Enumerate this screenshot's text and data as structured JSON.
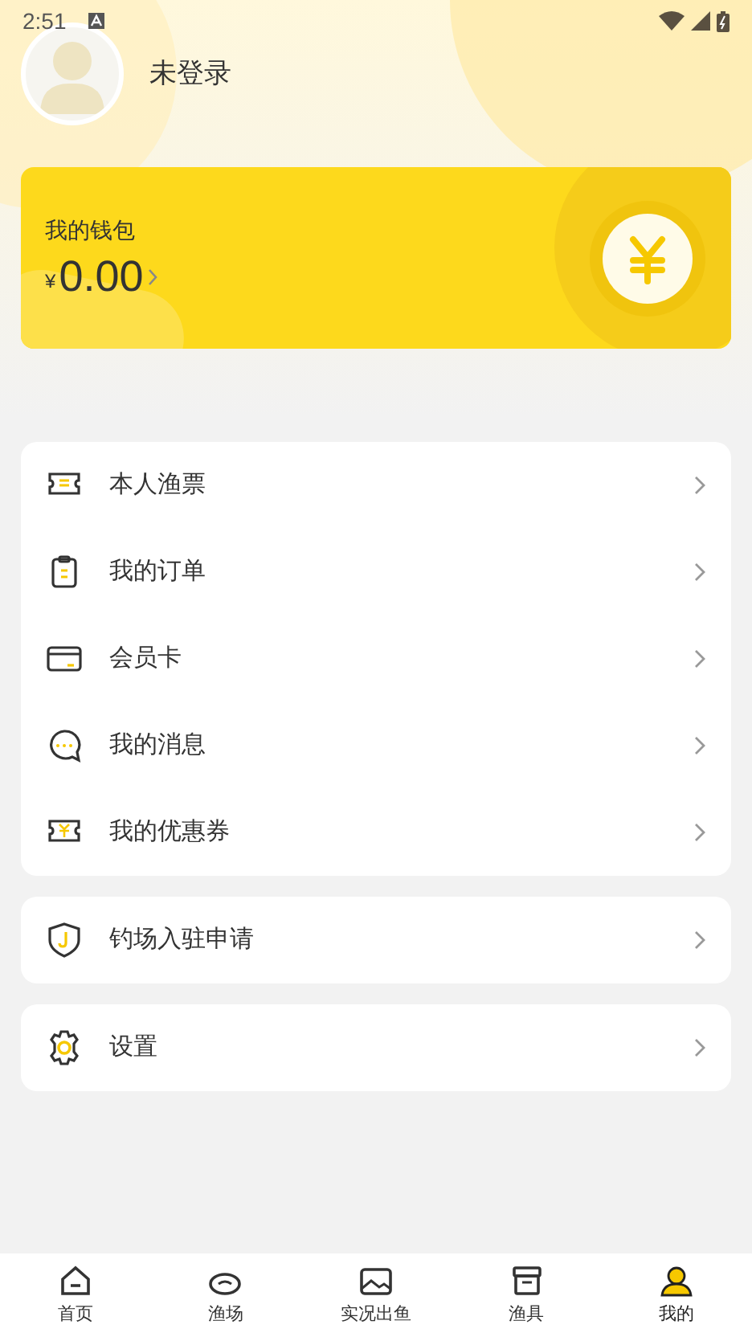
{
  "status_bar": {
    "time": "2:51"
  },
  "profile": {
    "name": "未登录"
  },
  "wallet": {
    "title": "我的钱包",
    "currency": "¥",
    "balance": "0.00"
  },
  "menu_groups": [
    {
      "items": [
        {
          "label": "本人渔票"
        },
        {
          "label": "我的订单"
        },
        {
          "label": "会员卡"
        },
        {
          "label": "我的消息"
        },
        {
          "label": "我的优惠券"
        }
      ]
    },
    {
      "items": [
        {
          "label": "钓场入驻申请"
        }
      ]
    },
    {
      "items": [
        {
          "label": "设置"
        }
      ]
    }
  ],
  "tab_bar": [
    {
      "label": "首页",
      "selected": false
    },
    {
      "label": "渔场",
      "selected": false
    },
    {
      "label": "实况出鱼",
      "selected": false
    },
    {
      "label": "渔具",
      "selected": false
    },
    {
      "label": "我的",
      "selected": true
    }
  ]
}
